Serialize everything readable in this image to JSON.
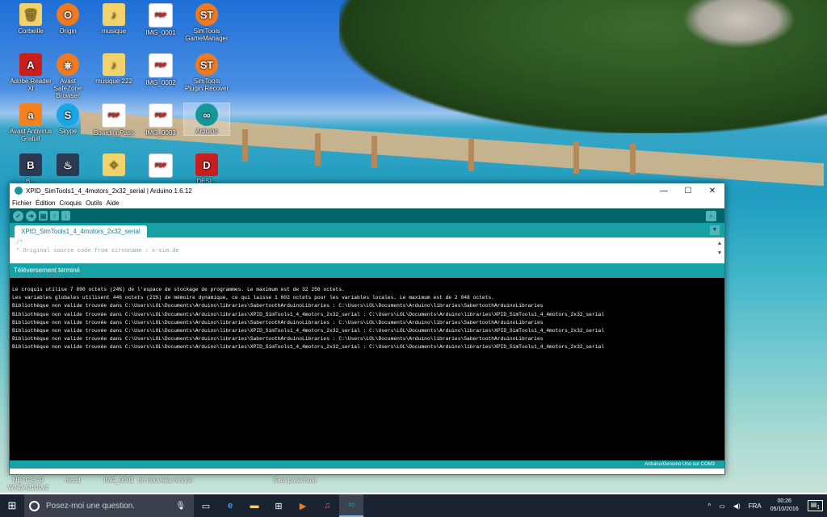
{
  "desktop": {
    "icons": [
      {
        "label": "Corbeille",
        "glyph": "🗑",
        "style": "folder"
      },
      {
        "label": "Origin",
        "glyph": "O",
        "style": "orange"
      },
      {
        "label": "musique",
        "glyph": "♪",
        "style": "folder"
      },
      {
        "label": "IMG_0001",
        "glyph": "PDF",
        "style": "pdf"
      },
      {
        "label": "SimTools GameManager",
        "glyph": "ST",
        "style": "orange"
      },
      {
        "label": "Adobe Reader XI",
        "glyph": "A",
        "style": "acro"
      },
      {
        "label": "Avast SafeZone Browser",
        "glyph": "⎈",
        "style": "orange"
      },
      {
        "label": "musique 222",
        "glyph": "♪",
        "style": "folder"
      },
      {
        "label": "IMG_0002",
        "glyph": "PDF",
        "style": "pdf"
      },
      {
        "label": "SimTools Plugin Recover",
        "glyph": "ST",
        "style": "orange"
      },
      {
        "label": "Avast Antivirus Gratuit",
        "glyph": "a",
        "style": "avast"
      },
      {
        "label": "Skype",
        "glyph": "S",
        "style": "blue"
      },
      {
        "label": "BoardingPass",
        "glyph": "PDF",
        "style": "pdf"
      },
      {
        "label": "IMG_0003",
        "glyph": "PDF",
        "style": "pdf"
      },
      {
        "label": "Arduino",
        "glyph": "∞",
        "style": "arduino-d"
      },
      {
        "label": "B...",
        "glyph": "B",
        "style": "dark"
      },
      {
        "label": "",
        "glyph": "♨",
        "style": "dark"
      },
      {
        "label": "",
        "glyph": "✦",
        "style": "folder"
      },
      {
        "label": "",
        "glyph": "PDF",
        "style": "pdf"
      },
      {
        "label": "DESI...",
        "glyph": "D",
        "style": "acro"
      }
    ],
    "bottom_labels": [
      "NETGEAR WNDA3100v2",
      "mccd",
      "IMG_0001",
      "un nouveau monde",
      "Saut parachute"
    ]
  },
  "window": {
    "title": "XPID_SimTools1_4_4motors_2x32_serial | Arduino 1.6.12",
    "menu": [
      "Fichier",
      "Édition",
      "Croquis",
      "Outils",
      "Aide"
    ],
    "tab": "XPID_SimTools1_4_4motors_2x32_serial",
    "editor_lines": [
      "/*",
      "* Original source code from sirnoname : x-sim.de"
    ],
    "status": "Téléversement terminé",
    "console": [
      "Le croquis utilise 7 890 octets (24%) de l'espace de stockage de programmes. Le maximum est de 32 256 octets.",
      "Les variables globales utilisent 446 octets (21%) de mémoire dynamique, ce qui laisse 1 602 octets pour les variables locales. Le maximum est de 2 048 octets.",
      "Bibliothèque non valide trouvée dans C:\\Users\\LOL\\Documents\\Arduino\\libraries\\SabertoothArduinoLibraries : C:\\Users\\LOL\\Documents\\Arduino\\libraries\\SabertoothArduinoLibraries",
      "Bibliothèque non valide trouvée dans C:\\Users\\LOL\\Documents\\Arduino\\libraries\\XPID_SimTools1_4_4motors_2x32_serial : C:\\Users\\LOL\\Documents\\Arduino\\libraries\\XPID_SimTools1_4_4motors_2x32_serial",
      "Bibliothèque non valide trouvée dans C:\\Users\\LOL\\Documents\\Arduino\\libraries\\SabertoothArduinoLibraries : C:\\Users\\LOL\\Documents\\Arduino\\libraries\\SabertoothArduinoLibraries",
      "Bibliothèque non valide trouvée dans C:\\Users\\LOL\\Documents\\Arduino\\libraries\\XPID_SimTools1_4_4motors_2x32_serial : C:\\Users\\LOL\\Documents\\Arduino\\libraries\\XPID_SimTools1_4_4motors_2x32_serial",
      "Bibliothèque non valide trouvée dans C:\\Users\\LOL\\Documents\\Arduino\\libraries\\SabertoothArduinoLibraries : C:\\Users\\LOL\\Documents\\Arduino\\libraries\\SabertoothArduinoLibraries",
      "Bibliothèque non valide trouvée dans C:\\Users\\LOL\\Documents\\Arduino\\libraries\\XPID_SimTools1_4_4motors_2x32_serial : C:\\Users\\LOL\\Documents\\Arduino\\libraries\\XPID_SimTools1_4_4motors_2x32_serial"
    ],
    "board": "Arduino/Genuino Uno sur COM3"
  },
  "taskbar": {
    "search_placeholder": "Posez-moi une question.",
    "lang": "FRA",
    "time": "00:26",
    "date": "05/10/2016",
    "notif_count": "1"
  },
  "colors": {
    "arduino_dark": "#006468",
    "arduino_teal": "#17a1a5",
    "taskbar": "#1c2330"
  }
}
